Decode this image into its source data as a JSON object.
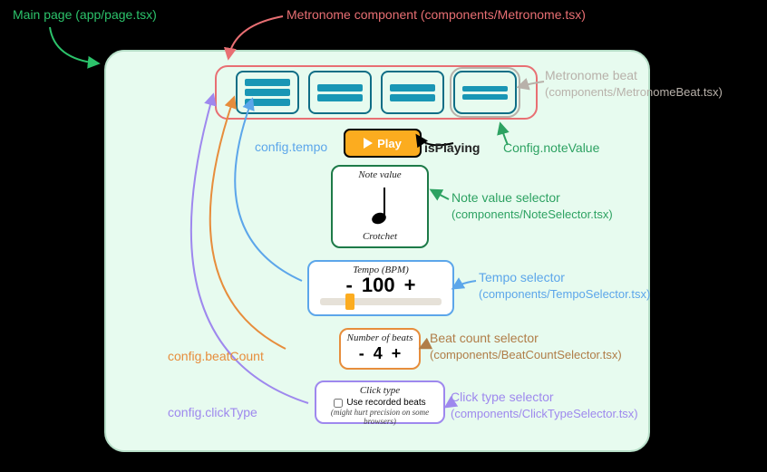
{
  "annotations": {
    "mainPage": "Main page (app/page.tsx)",
    "metronomeComponent": "Metronome component (components/Metronome.tsx)",
    "metronomeBeat_line1": "Metronome beat",
    "metronomeBeat_line2": "(components/MetronomeBeat.tsx)",
    "isPlaying": "isPlaying",
    "configTempo": "config.tempo",
    "configNoteValue": "Config.noteValue",
    "noteValueSelector_line1": "Note value selector",
    "noteValueSelector_line2": "(components/NoteSelector.tsx)",
    "tempoSelector_line1": "Tempo selector",
    "tempoSelector_line2": "(components/TempoSelector.tsx)",
    "configBeatCount": "config.beatCount",
    "beatCountSelector_line1": "Beat count selector",
    "beatCountSelector_line2": "(components/BeatCountSelector.tsx)",
    "configClickType": "config.clickType",
    "clickTypeSelector_line1": "Click type selector",
    "clickTypeSelector_line2": "(components/ClickTypeSelector.tsx)"
  },
  "play": {
    "label": "Play"
  },
  "noteValue": {
    "title": "Note value",
    "name": "Crotchet"
  },
  "tempo": {
    "title": "Tempo (BPM)",
    "value": "100",
    "minus": "-",
    "plus": "+"
  },
  "beatCount": {
    "title": "Number of beats",
    "value": "4",
    "minus": "-",
    "plus": "+"
  },
  "clickType": {
    "title": "Click type",
    "checkboxLabel": "Use recorded beats",
    "hint": "(might hurt precision on some browsers)"
  },
  "colors": {
    "beatrow": "#e86f73",
    "notevalue": "#1d7a48",
    "tempo": "#5ca6ea",
    "beatcount": "#e78d3c",
    "clicktype": "#9e88ee",
    "arrows": {
      "green": "#2cc36b",
      "purple": "#9e88ee",
      "blue": "#5ca6ea",
      "orange": "#e78d3c",
      "brown": "#b07d48",
      "red": "#e86f73",
      "grey": "#b8b1aa",
      "darkgreen": "#2da262"
    }
  }
}
